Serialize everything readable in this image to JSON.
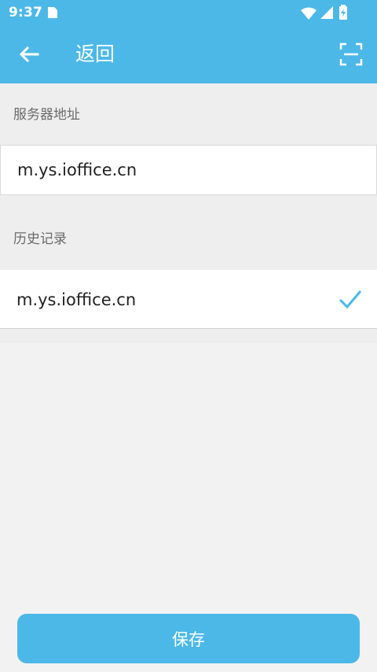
{
  "status_bar": {
    "time": "9:37",
    "icons": [
      "sim-card-icon",
      "wifi-icon",
      "signal-icon",
      "battery-charging-icon"
    ]
  },
  "app_bar": {
    "back_icon": "arrow-left-icon",
    "title": "返回",
    "scan_icon": "scan-frame-icon"
  },
  "server": {
    "label": "服务器地址",
    "value": "m.ys.ioffice.cn"
  },
  "history": {
    "label": "历史记录",
    "items": [
      {
        "address": "m.ys.ioffice.cn",
        "selected": true,
        "icon": "check-icon"
      }
    ]
  },
  "actions": {
    "save_label": "保存"
  },
  "colors": {
    "primary": "#4cb8e8",
    "background": "#f2f2f2",
    "panel": "#eeeeee",
    "text": "#222222",
    "muted_text": "#6b6b6b"
  }
}
